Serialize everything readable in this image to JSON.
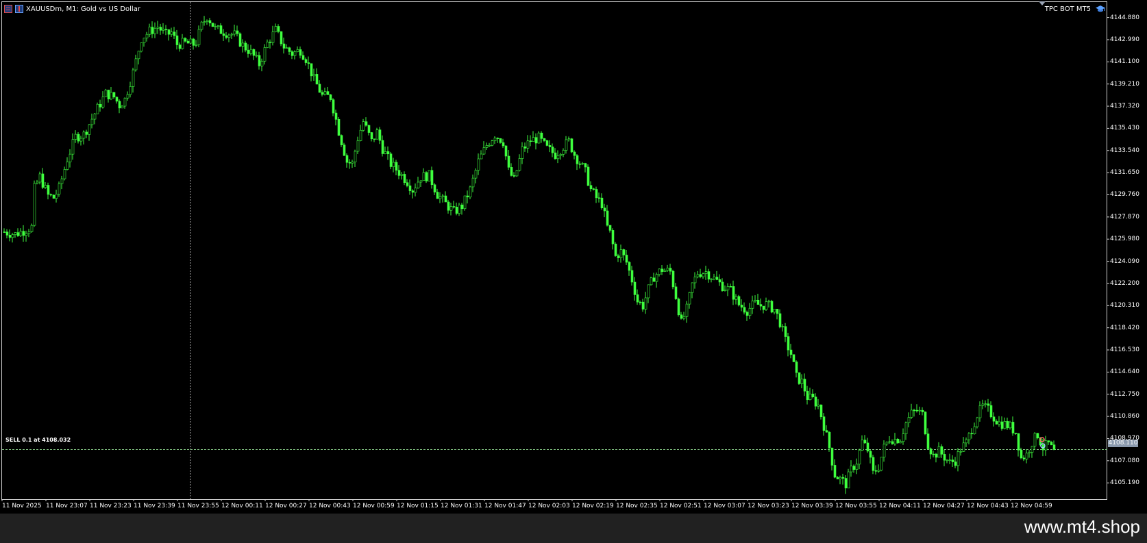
{
  "window": {
    "symbol_title": "XAUUSDm, M1:  Gold vs US Dollar",
    "bot_label": "TPC BOT MT5",
    "watermark": "www.mt4.shop"
  },
  "icons": [
    "grid-icon",
    "candle-icon",
    "graduation-cap-icon",
    "bot-status-triangle-icon"
  ],
  "colors": {
    "background": "#000000",
    "candle": "#3fff3f",
    "grid_line": "#888888",
    "order_line": "#7fbf7f",
    "price_tag_bg": "#8a99ad",
    "bottom_bar": "#212121"
  },
  "order": {
    "label": "SELL 0.1 at 4108.032",
    "price": 4108.032
  },
  "current_price": "4108.110",
  "chart_data": {
    "type": "candlestick",
    "timeframe": "M1",
    "ylim": [
      4103.8,
      4146.2
    ],
    "y_ticks": [
      "4144.880",
      "4142.990",
      "4141.100",
      "4139.210",
      "4137.320",
      "4135.430",
      "4133.540",
      "4131.650",
      "4129.760",
      "4127.870",
      "4125.980",
      "4124.090",
      "4122.200",
      "4120.310",
      "4118.420",
      "4116.530",
      "4114.640",
      "4112.750",
      "4110.860",
      "4108.970",
      "4107.080",
      "4105.190"
    ],
    "x_ticks": [
      "11 Nov 2025",
      "11 Nov 23:07",
      "11 Nov 23:23",
      "11 Nov 23:39",
      "11 Nov 23:55",
      "12 Nov 00:11",
      "12 Nov 00:27",
      "12 Nov 00:43",
      "12 Nov 00:59",
      "12 Nov 01:15",
      "12 Nov 01:31",
      "12 Nov 01:47",
      "12 Nov 02:03",
      "12 Nov 02:19",
      "12 Nov 02:35",
      "12 Nov 02:51",
      "12 Nov 03:07",
      "12 Nov 03:23",
      "12 Nov 03:39",
      "12 Nov 03:55",
      "12 Nov 04:11",
      "12 Nov 04:27",
      "12 Nov 04:43",
      "12 Nov 04:59"
    ],
    "grid": false,
    "crosshair_tick": "11 Nov 23:55",
    "price_path": [
      [
        0,
        4126.6
      ],
      [
        4,
        4126.4
      ],
      [
        8,
        4126.8
      ],
      [
        10,
        4127.0
      ],
      [
        11,
        4130.3
      ],
      [
        13,
        4131.3
      ],
      [
        16,
        4129.7
      ],
      [
        18,
        4129.5
      ],
      [
        20,
        4130.3
      ],
      [
        23,
        4132.8
      ],
      [
        26,
        4134.7
      ],
      [
        29,
        4134.9
      ],
      [
        33,
        4136.7
      ],
      [
        37,
        4138.4
      ],
      [
        40,
        4138.1
      ],
      [
        42,
        4137.4
      ],
      [
        44,
        4137.9
      ],
      [
        47,
        4140.2
      ],
      [
        50,
        4143.1
      ],
      [
        53,
        4143.7
      ],
      [
        56,
        4144.1
      ],
      [
        59,
        4143.4
      ],
      [
        61,
        4143.6
      ],
      [
        63,
        4142.6
      ],
      [
        66,
        4142.7
      ],
      [
        69,
        4142.6
      ],
      [
        70,
        4142.8
      ],
      [
        72,
        4144.2
      ],
      [
        74,
        4145.0
      ],
      [
        77,
        4143.9
      ],
      [
        81,
        4143.6
      ],
      [
        84,
        4143.4
      ],
      [
        87,
        4142.5
      ],
      [
        90,
        4141.9
      ],
      [
        93,
        4140.9
      ],
      [
        96,
        4142.7
      ],
      [
        99,
        4143.8
      ],
      [
        102,
        4142.4
      ],
      [
        105,
        4141.8
      ],
      [
        108,
        4142.1
      ],
      [
        110,
        4141.4
      ],
      [
        113,
        4139.6
      ],
      [
        116,
        4138.2
      ],
      [
        119,
        4138.1
      ],
      [
        122,
        4135.2
      ],
      [
        125,
        4132.6
      ],
      [
        127,
        4132.4
      ],
      [
        129,
        4134.6
      ],
      [
        131,
        4136.0
      ],
      [
        134,
        4134.3
      ],
      [
        136,
        4135.1
      ],
      [
        138,
        4133.7
      ],
      [
        141,
        4132.4
      ],
      [
        144,
        4131.7
      ],
      [
        147,
        4130.9
      ],
      [
        149,
        4130.2
      ],
      [
        152,
        4131.3
      ],
      [
        155,
        4131.4
      ],
      [
        158,
        4129.8
      ],
      [
        161,
        4129.0
      ],
      [
        164,
        4128.3
      ],
      [
        167,
        4128.8
      ],
      [
        170,
        4130.2
      ],
      [
        173,
        4132.6
      ],
      [
        176,
        4134.0
      ],
      [
        179,
        4134.9
      ],
      [
        182,
        4134.3
      ],
      [
        184,
        4131.8
      ],
      [
        186,
        4131.0
      ],
      [
        189,
        4133.6
      ],
      [
        192,
        4134.4
      ],
      [
        195,
        4134.6
      ],
      [
        198,
        4133.7
      ],
      [
        201,
        4133.2
      ],
      [
        204,
        4133.9
      ],
      [
        206,
        4134.3
      ],
      [
        208,
        4133.2
      ],
      [
        210,
        4132.5
      ],
      [
        212,
        4131.7
      ],
      [
        214,
        4130.2
      ],
      [
        216,
        4129.5
      ],
      [
        218,
        4129.0
      ],
      [
        220,
        4127.0
      ],
      [
        221,
        4126.5
      ],
      [
        223,
        4124.5
      ],
      [
        225,
        4124.9
      ],
      [
        227,
        4124.0
      ],
      [
        229,
        4122.5
      ],
      [
        231,
        4120.7
      ],
      [
        233,
        4120.3
      ],
      [
        235,
        4121.7
      ],
      [
        237,
        4122.8
      ],
      [
        240,
        4123.4
      ],
      [
        243,
        4123.2
      ],
      [
        245,
        4121.1
      ],
      [
        247,
        4118.8
      ],
      [
        249,
        4120.0
      ],
      [
        251,
        4122.1
      ],
      [
        253,
        4123.1
      ],
      [
        256,
        4123.2
      ],
      [
        259,
        4122.6
      ],
      [
        262,
        4122.0
      ],
      [
        265,
        4121.6
      ],
      [
        268,
        4120.4
      ],
      [
        271,
        4119.9
      ],
      [
        274,
        4120.5
      ],
      [
        276,
        4120.3
      ],
      [
        278,
        4120.4
      ],
      [
        281,
        4120.0
      ],
      [
        283,
        4118.9
      ],
      [
        285,
        4117.3
      ],
      [
        287,
        4116.2
      ],
      [
        289,
        4114.2
      ],
      [
        291,
        4113.8
      ],
      [
        293,
        4112.5
      ],
      [
        295,
        4112.3
      ],
      [
        297,
        4111.8
      ],
      [
        299,
        4110.1
      ],
      [
        301,
        4108.2
      ],
      [
        303,
        4105.9
      ],
      [
        305,
        4105.5
      ],
      [
        307,
        4105.1
      ],
      [
        309,
        4106.3
      ],
      [
        311,
        4107.0
      ],
      [
        313,
        4108.7
      ],
      [
        315,
        4108.0
      ],
      [
        317,
        4106.0
      ],
      [
        319,
        4106.6
      ],
      [
        321,
        4108.2
      ],
      [
        323,
        4109.0
      ],
      [
        325,
        4108.9
      ],
      [
        327,
        4109.0
      ],
      [
        329,
        4110.3
      ],
      [
        331,
        4111.1
      ],
      [
        333,
        4111.4
      ],
      [
        335,
        4111.0
      ],
      [
        337,
        4108.5
      ],
      [
        339,
        4107.5
      ],
      [
        341,
        4107.9
      ],
      [
        343,
        4107.4
      ],
      [
        345,
        4106.9
      ],
      [
        347,
        4107.1
      ],
      [
        349,
        4108.1
      ],
      [
        351,
        4108.6
      ],
      [
        353,
        4109.8
      ],
      [
        355,
        4111.0
      ],
      [
        357,
        4111.7
      ],
      [
        359,
        4111.4
      ],
      [
        361,
        4110.8
      ],
      [
        363,
        4110.3
      ],
      [
        365,
        4110.2
      ],
      [
        367,
        4110.0
      ],
      [
        369,
        4109.5
      ],
      [
        371,
        4107.3
      ],
      [
        373,
        4107.6
      ],
      [
        375,
        4108.7
      ],
      [
        377,
        4109.3
      ],
      [
        379,
        4108.2
      ],
      [
        381,
        4108.5
      ],
      [
        383,
        4107.8
      ]
    ]
  }
}
